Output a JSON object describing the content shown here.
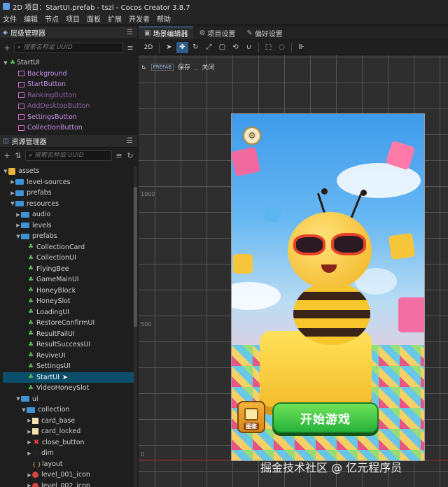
{
  "window": {
    "title": "2D 项目：StartUI.prefab - tszl - Cocos Creator 3.8.7"
  },
  "menubar": [
    "文件",
    "编辑",
    "节点",
    "项目",
    "面板",
    "扩展",
    "开发者",
    "帮助"
  ],
  "hierarchy": {
    "title": "层级管理器",
    "search_placeholder": "搜索名称或 UUID",
    "root": "StartUI",
    "children": [
      "Background",
      "StartButton",
      "RankingButton",
      "AddDesktopButton",
      "SettingsButton",
      "CollectionButton"
    ]
  },
  "assets": {
    "title": "资源管理器",
    "search_placeholder": "搜索名称或 UUID",
    "root": "assets",
    "folders": {
      "level_sources": "level-sources",
      "prefabs_top": "prefabs",
      "resources": "resources",
      "audio": "audio",
      "levels": "levels",
      "prefabs": "prefabs",
      "ui": "ui",
      "collection": "collection"
    },
    "prefab_items": [
      "CollectionCard",
      "CollectionUI",
      "FlyingBee",
      "GameMainUI",
      "HoneyBlock",
      "HoneySlot",
      "LoadingUI",
      "RestoreConfirmUI",
      "ResultFailUI",
      "ResultSuccessUI",
      "ReviveUI",
      "SettingsUI",
      "StartUI",
      "VideoHoneySlot"
    ],
    "collection_items": [
      "card_base",
      "card_locked",
      "close_button",
      "dim",
      "layout",
      "level_001_icon",
      "level_002_icon"
    ]
  },
  "tabs": [
    "场景编辑器",
    "项目设置",
    "偏好设置"
  ],
  "toolbar": {
    "mode_2d": "2D"
  },
  "scene": {
    "prefab_tag": "PREFAB",
    "save_label": "保存",
    "close_label": "关闭",
    "ruler_1000": "1000",
    "ruler_500": "500",
    "ruler_0": "0"
  },
  "game_ui": {
    "start_button": "开始游戏",
    "collection_label": "图鉴"
  },
  "watermark": "掘金技术社区 @ 亿元程序员",
  "colors": {
    "selection": "#0b4f6c",
    "node_purple": "#c58ee8",
    "start_green": "#26b23a"
  }
}
